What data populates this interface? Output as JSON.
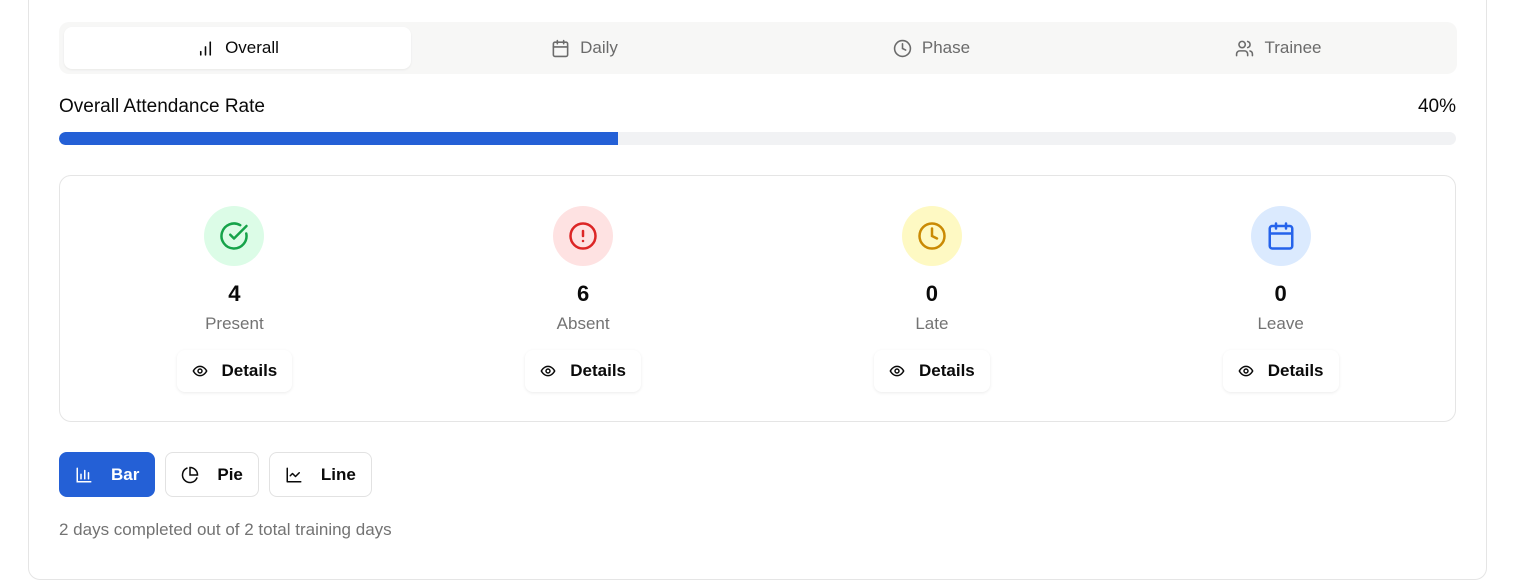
{
  "tabs": [
    {
      "label": "Overall",
      "icon": "bar-chart-icon",
      "active": true
    },
    {
      "label": "Daily",
      "icon": "calendar-icon",
      "active": false
    },
    {
      "label": "Phase",
      "icon": "clock-icon",
      "active": false
    },
    {
      "label": "Trainee",
      "icon": "users-icon",
      "active": false
    }
  ],
  "rate": {
    "title": "Overall Attendance Rate",
    "value_text": "40%",
    "progress_fraction": 0.4,
    "bar_color": "#2460d6"
  },
  "stats": [
    {
      "count": "4",
      "label": "Present",
      "icon": "check-circle-icon",
      "icon_color": "#16a34a",
      "bg": "#dcfce7",
      "details_label": "Details"
    },
    {
      "count": "6",
      "label": "Absent",
      "icon": "alert-circle-icon",
      "icon_color": "#dc2626",
      "bg": "#fee2e2",
      "details_label": "Details"
    },
    {
      "count": "0",
      "label": "Late",
      "icon": "clock-icon",
      "icon_color": "#ca8a04",
      "bg": "#fef9c3",
      "details_label": "Details"
    },
    {
      "count": "0",
      "label": "Leave",
      "icon": "calendar-icon",
      "icon_color": "#2563eb",
      "bg": "#dbeafe",
      "details_label": "Details"
    }
  ],
  "chart_types": [
    {
      "label": "Bar",
      "icon": "bar-chart-icon",
      "active": true
    },
    {
      "label": "Pie",
      "icon": "pie-chart-icon",
      "active": false
    },
    {
      "label": "Line",
      "icon": "line-chart-icon",
      "active": false
    }
  ],
  "footnote": "2 days completed out of 2 total training days"
}
